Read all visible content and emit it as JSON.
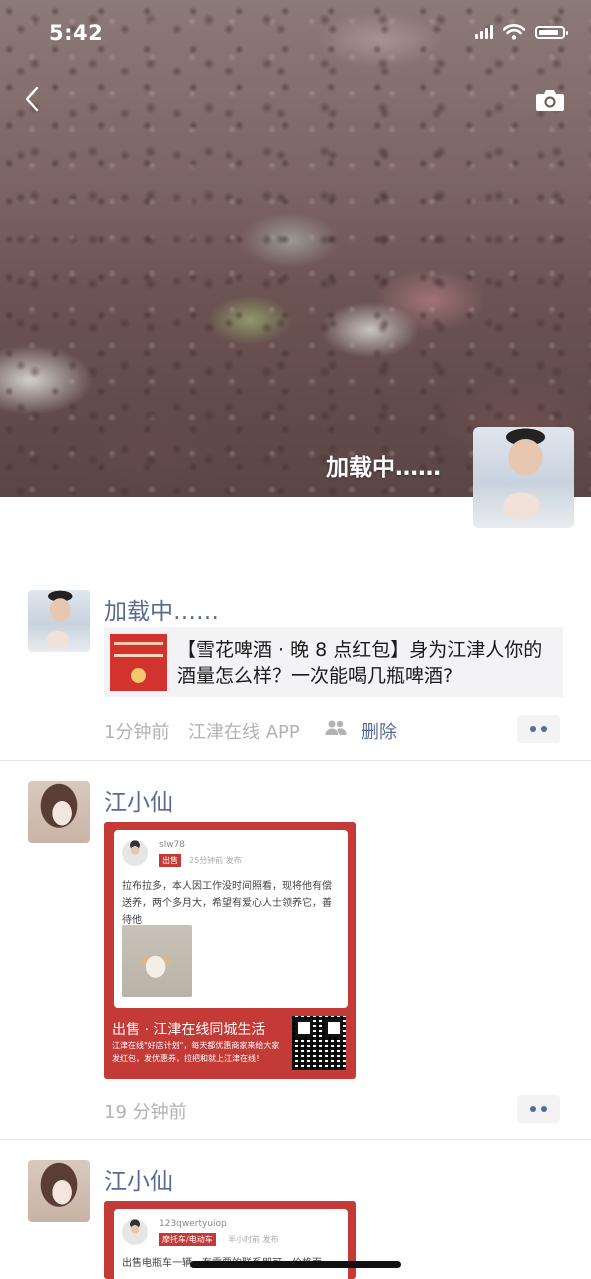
{
  "status_bar": {
    "time": "5:42"
  },
  "cover": {
    "user_name": "加载中……"
  },
  "posts": [
    {
      "name": "加载中……",
      "link_title": "【雪花啤酒 · 晚 8 点红包】身为江津人你的酒量怎么样？一次能喝几瓶啤酒?",
      "time": "1分钟前",
      "source": "江津在线 APP",
      "delete_label": "删除"
    },
    {
      "name": "江小仙",
      "time": "19 分钟前",
      "shot": {
        "user": "slw78",
        "tag": "出售",
        "tag_time": "25分钟前 发布",
        "body": "拉布拉多，本人因工作没时间照看，现将他有偿送养，两个多月大，希望有爱心人士领养它，善待他",
        "footer_title": "出售 · 江津在线同城生活",
        "footer_sub": "江津在线\"好店计划\"，每天都优惠商家来给大家发红包，发优惠券，拉把和就上江津在线！"
      }
    },
    {
      "name": "江小仙",
      "shot": {
        "user": "123qwertyuiop",
        "tag": "摩托车/电动车",
        "tag_time": "半小时前 发布",
        "body": "出售电瓶车一辆，有需要的联系即可，价格面"
      }
    }
  ]
}
